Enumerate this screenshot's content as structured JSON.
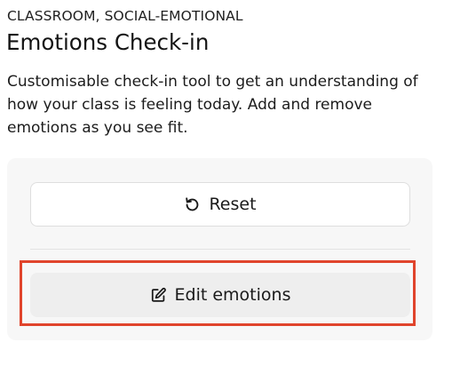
{
  "header": {
    "category": "CLASSROOM, SOCIAL-EMOTIONAL",
    "title": "Emotions Check-in",
    "description": "Customisable check-in tool to get an understanding of how your class is feeling today. Add and remove emotions as you see fit."
  },
  "panel": {
    "reset_label": "Reset",
    "reset_icon": "reset-icon",
    "edit_label": "Edit emotions",
    "edit_icon": "edit-icon"
  },
  "colors": {
    "highlight": "#e0442c",
    "panel_background": "#f7f7f7",
    "edit_button_background": "#eeeeee"
  }
}
